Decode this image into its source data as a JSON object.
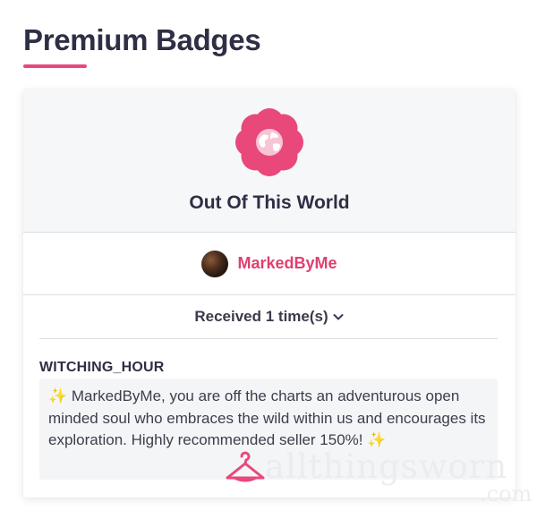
{
  "page": {
    "title": "Premium Badges"
  },
  "badge": {
    "name": "Out Of This World",
    "icon": "globe-flower-icon",
    "accent_color": "#e8487a"
  },
  "recipient": {
    "name": "MarkedByMe",
    "avatar": "avatar"
  },
  "received": {
    "label": "Received 1 time(s)",
    "icon": "chevron-down-icon"
  },
  "comment": {
    "author": "WITCHING_HOUR",
    "text": "✨ MarkedByMe, you are off the charts an adventurous open minded soul who embraces the wild within us and encourages its exploration. Highly recommended seller 150%! ✨"
  },
  "watermark": {
    "text": "allthingsworn",
    "suffix": ".com",
    "icon": "hanger-icon"
  }
}
